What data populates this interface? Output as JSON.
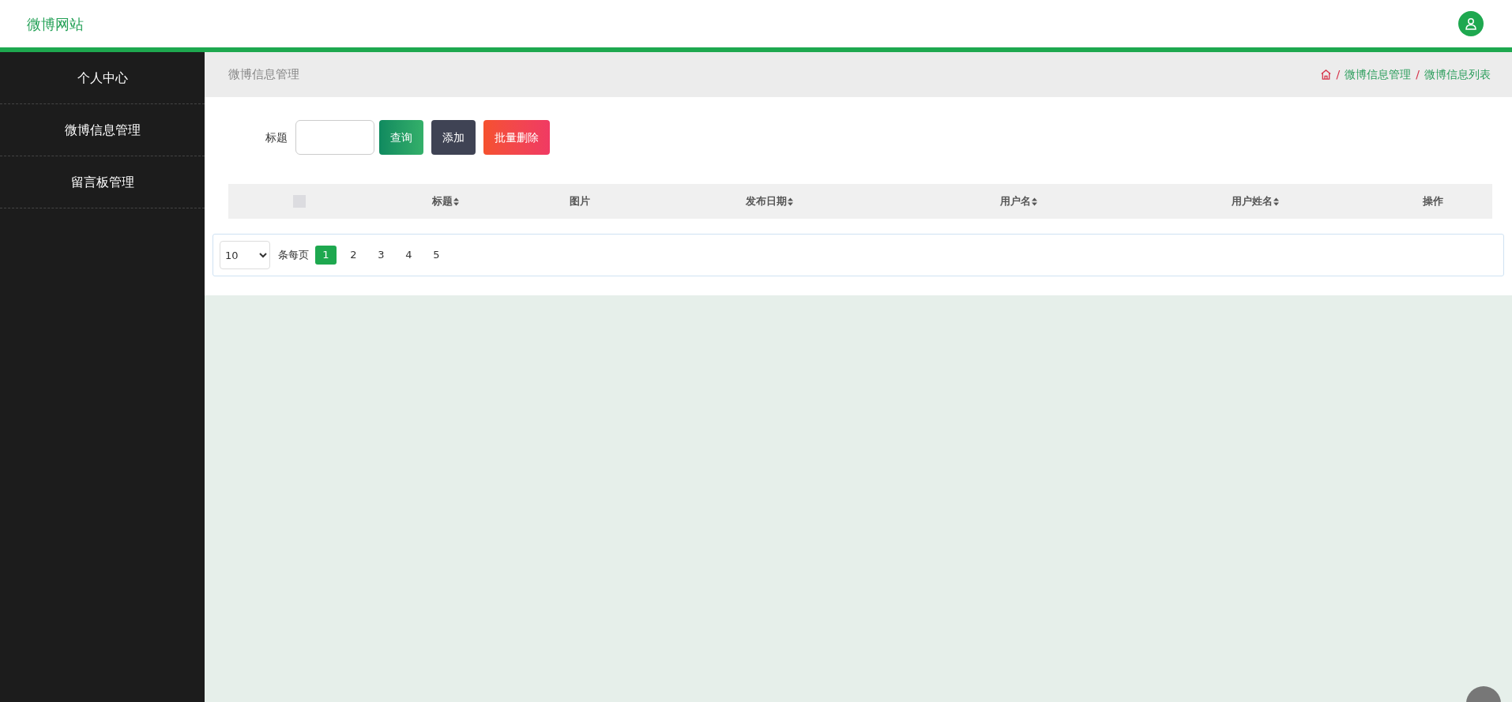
{
  "header": {
    "site_title": "微博网站"
  },
  "sidebar": {
    "items": [
      {
        "label": "个人中心"
      },
      {
        "label": "微博信息管理"
      },
      {
        "label": "留言板管理"
      }
    ]
  },
  "page_header": {
    "title": "微博信息管理",
    "breadcrumb": {
      "separator": "/",
      "items": [
        "微博信息管理",
        "微博信息列表"
      ]
    }
  },
  "search": {
    "label": "标题",
    "buttons": [
      {
        "label": "查询",
        "kind": "search"
      },
      {
        "label": "添加",
        "kind": "add"
      },
      {
        "label": "批量删除",
        "kind": "delete"
      }
    ]
  },
  "table": {
    "select_all": {
      "checked": false
    },
    "columns": [
      {
        "label": "标题",
        "sortable": true
      },
      {
        "label": "图片",
        "sortable": false
      },
      {
        "label": "发布日期",
        "sortable": true
      },
      {
        "label": "用户名",
        "sortable": true
      },
      {
        "label": "用户姓名",
        "sortable": true
      },
      {
        "label": "操作",
        "sortable": false
      }
    ]
  },
  "pagination": {
    "page_size": "10",
    "page_size_label": "条每页",
    "pages": [
      {
        "label": "1",
        "selected": true
      },
      {
        "label": "2",
        "selected": false
      },
      {
        "label": "3",
        "selected": false
      },
      {
        "label": "4",
        "selected": false
      },
      {
        "label": "5",
        "selected": false
      }
    ]
  }
}
